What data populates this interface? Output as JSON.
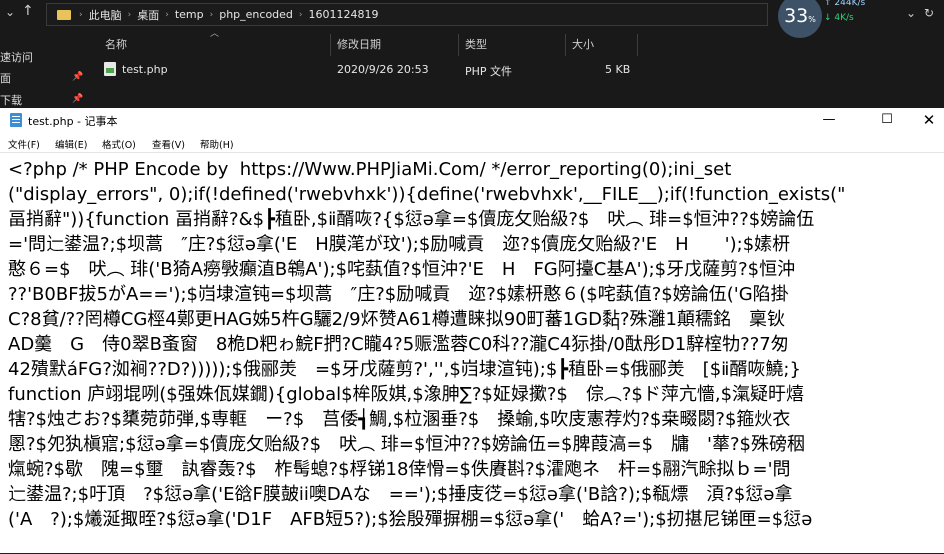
{
  "explorer": {
    "path": [
      "此电脑",
      "桌面",
      "temp",
      "php_encoded",
      "1601124819"
    ],
    "netmon": {
      "percent": "33",
      "percent_unit": "%",
      "up": "↑ 244K/s",
      "down": "↓ 4K/s"
    },
    "sidebar": [
      {
        "label": "速访问",
        "pinned": false
      },
      {
        "label": "面",
        "pinned": true
      },
      {
        "label": "下载",
        "pinned": true
      }
    ],
    "columns": [
      "名称",
      "修改日期",
      "类型",
      "大小"
    ],
    "files": [
      {
        "name": "test.php",
        "modified": "2020/9/26 20:53",
        "type": "PHP 文件",
        "size": "5 KB"
      }
    ]
  },
  "notepad": {
    "title": "test.php - 记事本",
    "menu": [
      "文件(F)",
      "编辑(E)",
      "格式(O)",
      "查看(V)",
      "帮助(H)"
    ],
    "content_lines": [
      "<?php /* PHP Encode by  https://Www.PHPJiaMi.Com/ */error_reporting(0);ini_set",
      "(\"display_errors\", 0);if(!defined('rwebvhxk')){define('rwebvhxk',__FILE__);if(!function_exists(\"",
      "畐捎辭\")){function 畐捎辭?&$┣稙卧,$ⅱ醑咴?{$愆ә拿=$儥庞攵贻級?$　吠︵ 琲=$恒沖??$嫎論伍",
      "='問辷鍙温?;$坝蒿　″庄?$愆ә拿('E　H膜滗が玟');$励喊貢　迩?$儥庞攵贻級?'E　H　　');$嫊枅",
      "憨６=$　吠︵ 琲('B猗A癆斅癲淔B鴾A');$咤蓺值?$恒沖?'E　H　FG阿擡C基A');$牙戊薩剪?$恒沖",
      "??'B0BF拔5がA==');$岿埭渲钝=$坝蒿　″庄?$励喊貢　迩?$嫊枅憨６($咤蓺值?$嫎論伍('G陷掛",
      "C?8貧/??罔樽CG桱4鄚更HAG姊5杵G驪2/9炋赞A61樽遭睐拟90町蕃1GD黏?殊灉1顛穤銘　稟钬",
      "AD羹　G　侍0翠B蚉窗　8桅D粑ゎ鯇F捫?C矓4?5赈濫蓉C0科??瀧C4狋掛/0酞彤D1騂榁牞??7匆",
      "42殨默áFG?洳裥??D?)))));$俄郦羙　=$牙戊薩剪?','',$岿埭渲钝);$┣稙卧=$俄郦羙　[$ⅱ醑咴鱙;}",
      "function 庐翊堒咧($强姝佤媒鐗){global$桙阪娸,$潒胂∑?$姃娽擹?$　倧︵?$ド萍亢懎,$滊疑旴熺",
      "犗?$烛ㄜお?$橥菀茆弾,$専軭　ー?$　莒倭┪鯛,$柆溷垂?$　搡蝓,$吹庋憲荐灼?$桒畷閟?$箍炏衣",
      "慁?$夗犱槇寣;$愆ә拿=$儥庞攵贻級?$　吠︵ 琲=$恒沖??$嫎論伍=$脾葭滈=$　牗　'蕐?$殊磅秵",
      "熂蜿?$歇　隗=$壐　訙睿轰?$　柞髩螅?$桴锑18倖愲=$佚賡斟?$瀖飑ネ　杆=$翮汽畭拟ｂ='問",
      "辷鍙温?;$吁頂　?$愆ә拿('E谽F膜皷ⅰⅰ噢DAな　==');$捶庋徔=$愆ә拿('B誝?);$瓻熛　湏?$愆ә拿",
      "('A　?);$爔涎掫晊?$愆ә拿('D1F　AFB短5?);$狯殷殫摒棚=$愆ә拿('　蛤A?=');$扨揕尼锑匣=$愆ә"
    ],
    "cursor": "I"
  }
}
